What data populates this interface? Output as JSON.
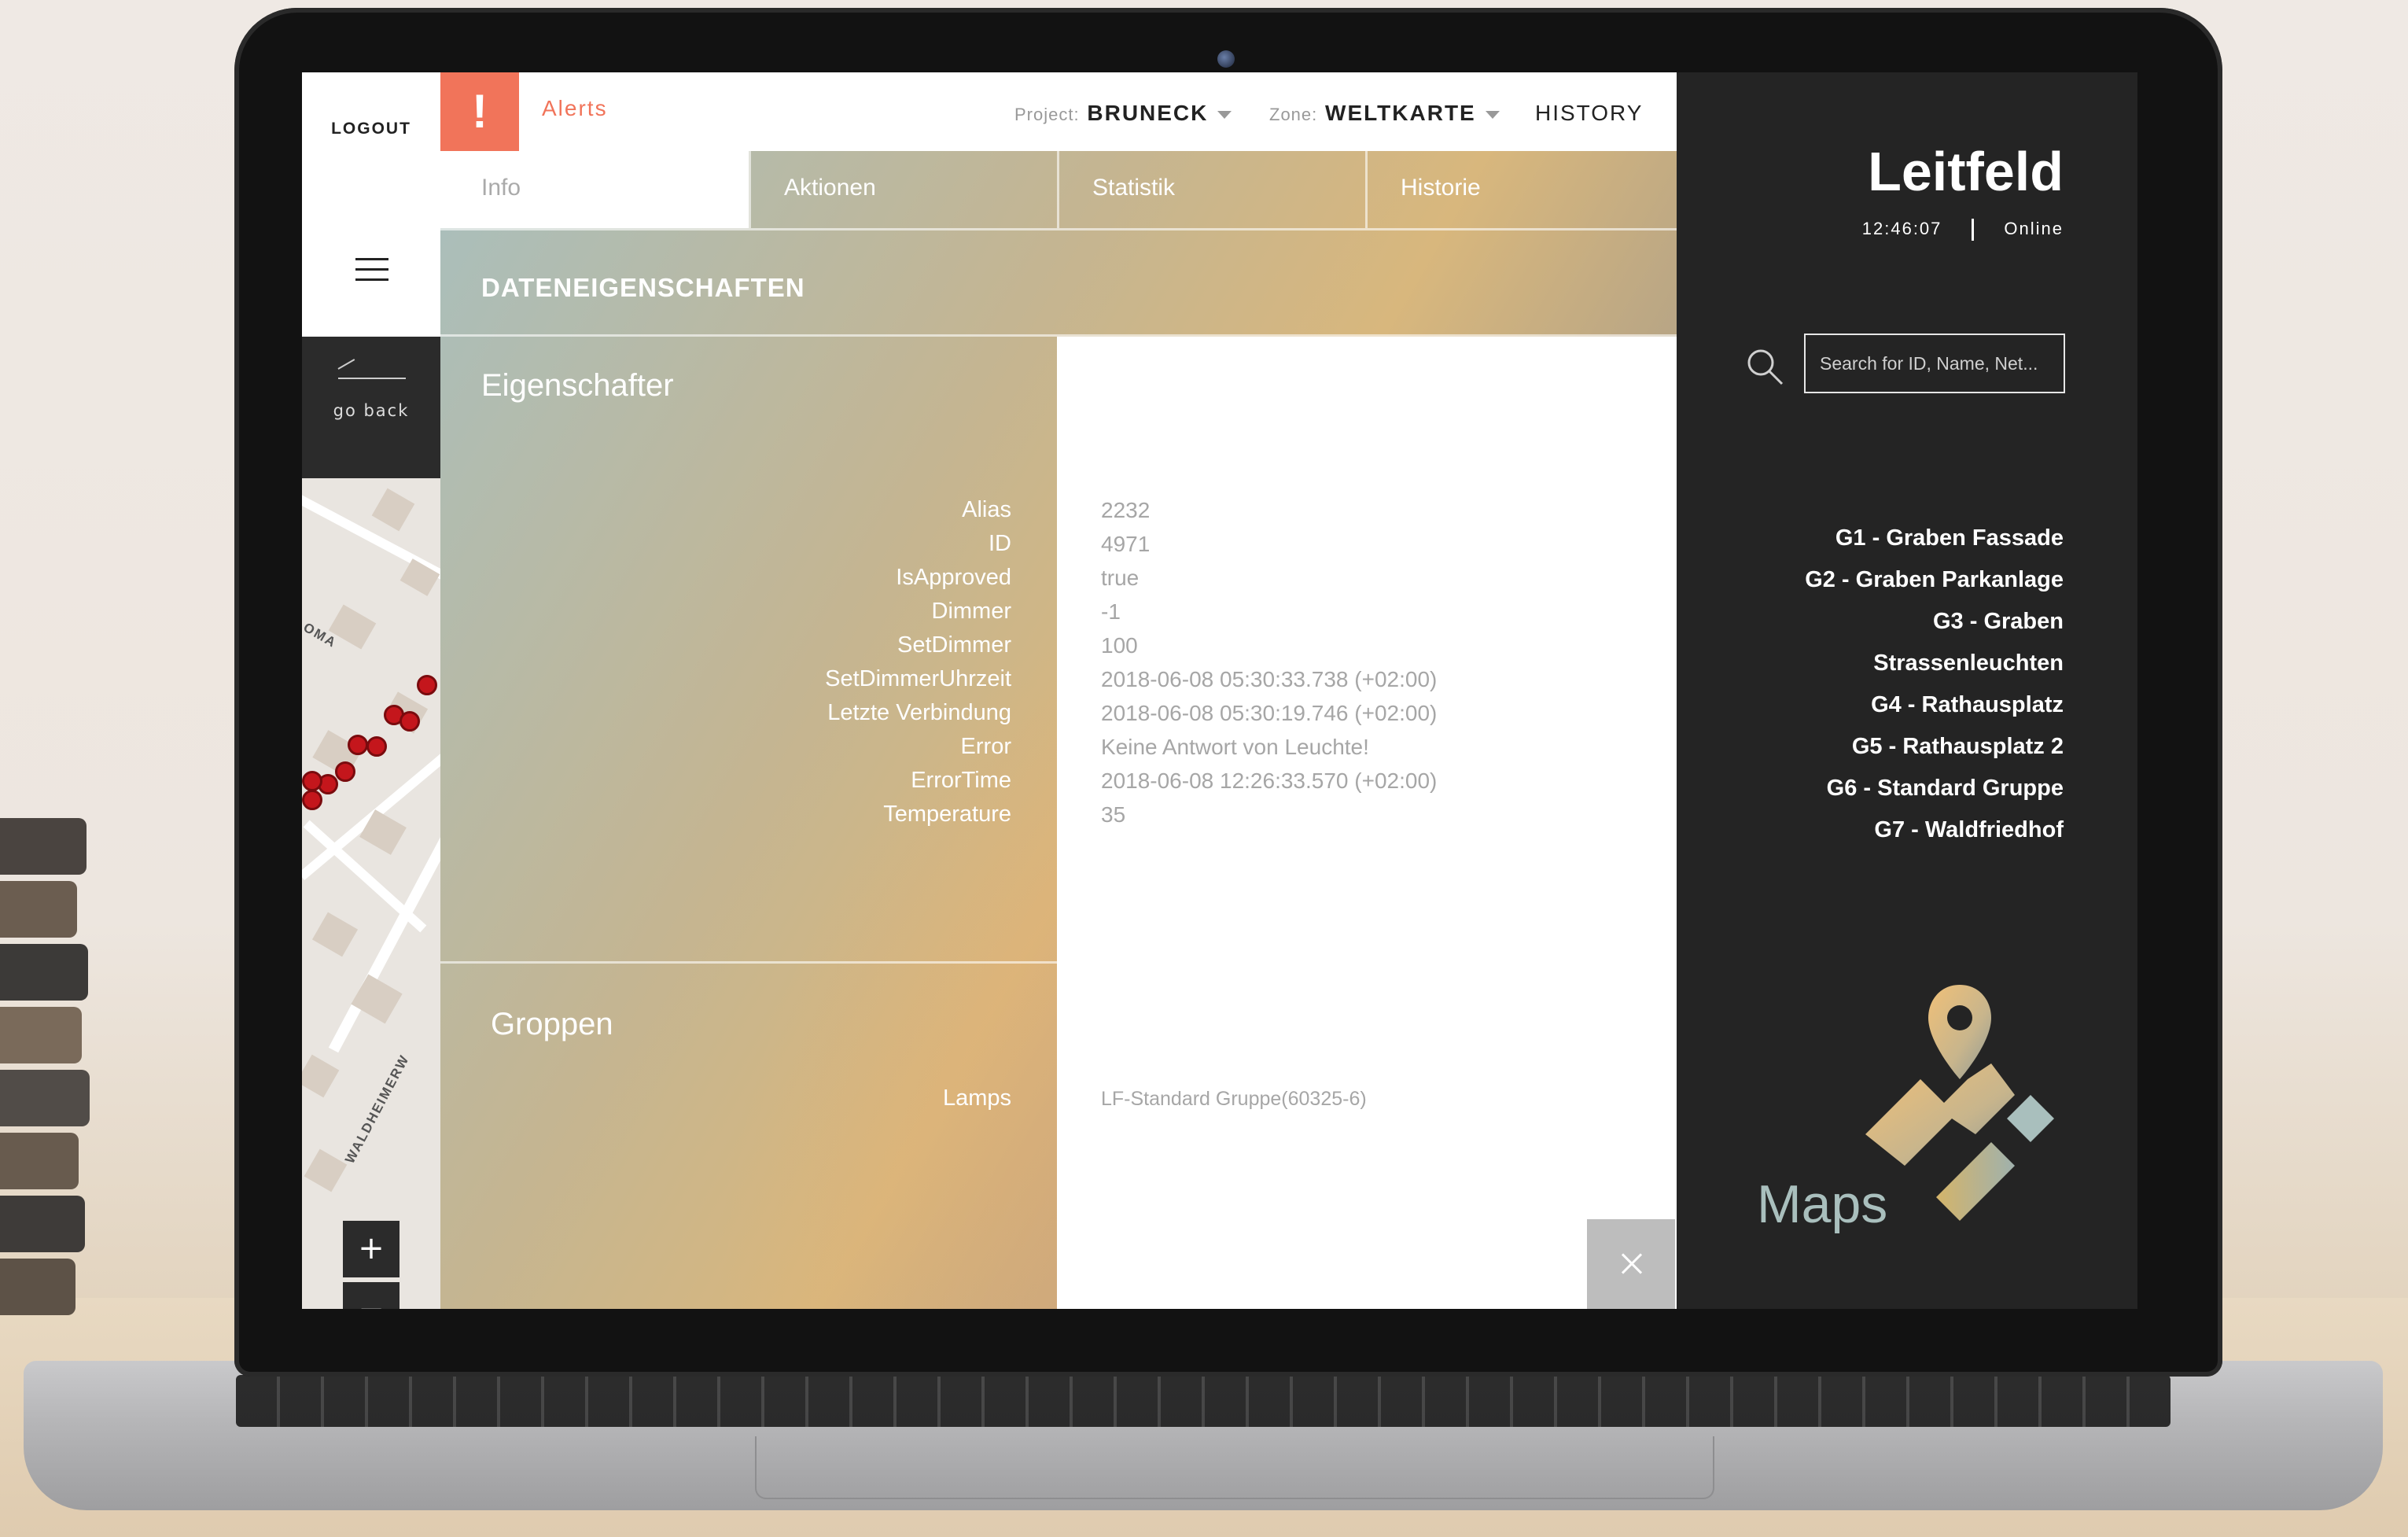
{
  "app": {
    "logout_label": "LOGOUT",
    "go_back_label": "go back",
    "alerts_icon": "!",
    "alerts_label": "Alerts"
  },
  "topbar": {
    "project_prefix": "Project:",
    "project_value": "BRUNECK",
    "zone_prefix": "Zone:",
    "zone_value": "WELTKARTE",
    "history_label": "HISTORY"
  },
  "tabs": [
    {
      "label": "Info",
      "active": true
    },
    {
      "label": "Aktionen",
      "active": false
    },
    {
      "label": "Statistik",
      "active": false
    },
    {
      "label": "Historie",
      "active": false
    }
  ],
  "section": {
    "title": "DATENEIGENSCHAFTEN",
    "properties_title": "Eigenschafter",
    "properties": [
      {
        "label": "Alias",
        "value": "2232"
      },
      {
        "label": "ID",
        "value": "4971"
      },
      {
        "label": "IsApproved",
        "value": "true"
      },
      {
        "label": "Dimmer",
        "value": "-1"
      },
      {
        "label": "SetDimmer",
        "value": "100"
      },
      {
        "label": "SetDimmerUhrzeit",
        "value": "2018-06-08 05:30:33.738 (+02:00)"
      },
      {
        "label": "Letzte Verbindung",
        "value": "2018-06-08 05:30:19.746 (+02:00)"
      },
      {
        "label": "Error",
        "value": "Keine Antwort von Leuchte!"
      },
      {
        "label": "ErrorTime",
        "value": "2018-06-08 12:26:33.570 (+02:00)"
      },
      {
        "label": "Temperature",
        "value": "35"
      }
    ],
    "groups_title": "Groppen",
    "groups": [
      {
        "label": "Lamps",
        "value": "LF-Standard Gruppe(60325-6)"
      }
    ]
  },
  "map": {
    "street_label_1": "OMA",
    "street_label_2": "WALDHEIMERW",
    "zoom_in": "+",
    "zoom_out": "−"
  },
  "sidebar": {
    "brand": "Leitfeld",
    "time": "12:46:07",
    "status": "Online",
    "search_placeholder": "Search for ID, Name, Net...",
    "groups": [
      "G1 - Graben Fassade",
      "G2 - Graben Parkanlage",
      "G3 - Graben",
      "Strassenleuchten",
      "G4 - Rathausplatz",
      "G5 - Rathausplatz 2",
      "G6 - Standard Gruppe",
      "G7 - Waldfriedhof"
    ],
    "maps_label": "Maps"
  },
  "colors": {
    "accent": "#f1745a",
    "sidebar_bg": "#242424",
    "maps_text": "#a9bfbd"
  }
}
